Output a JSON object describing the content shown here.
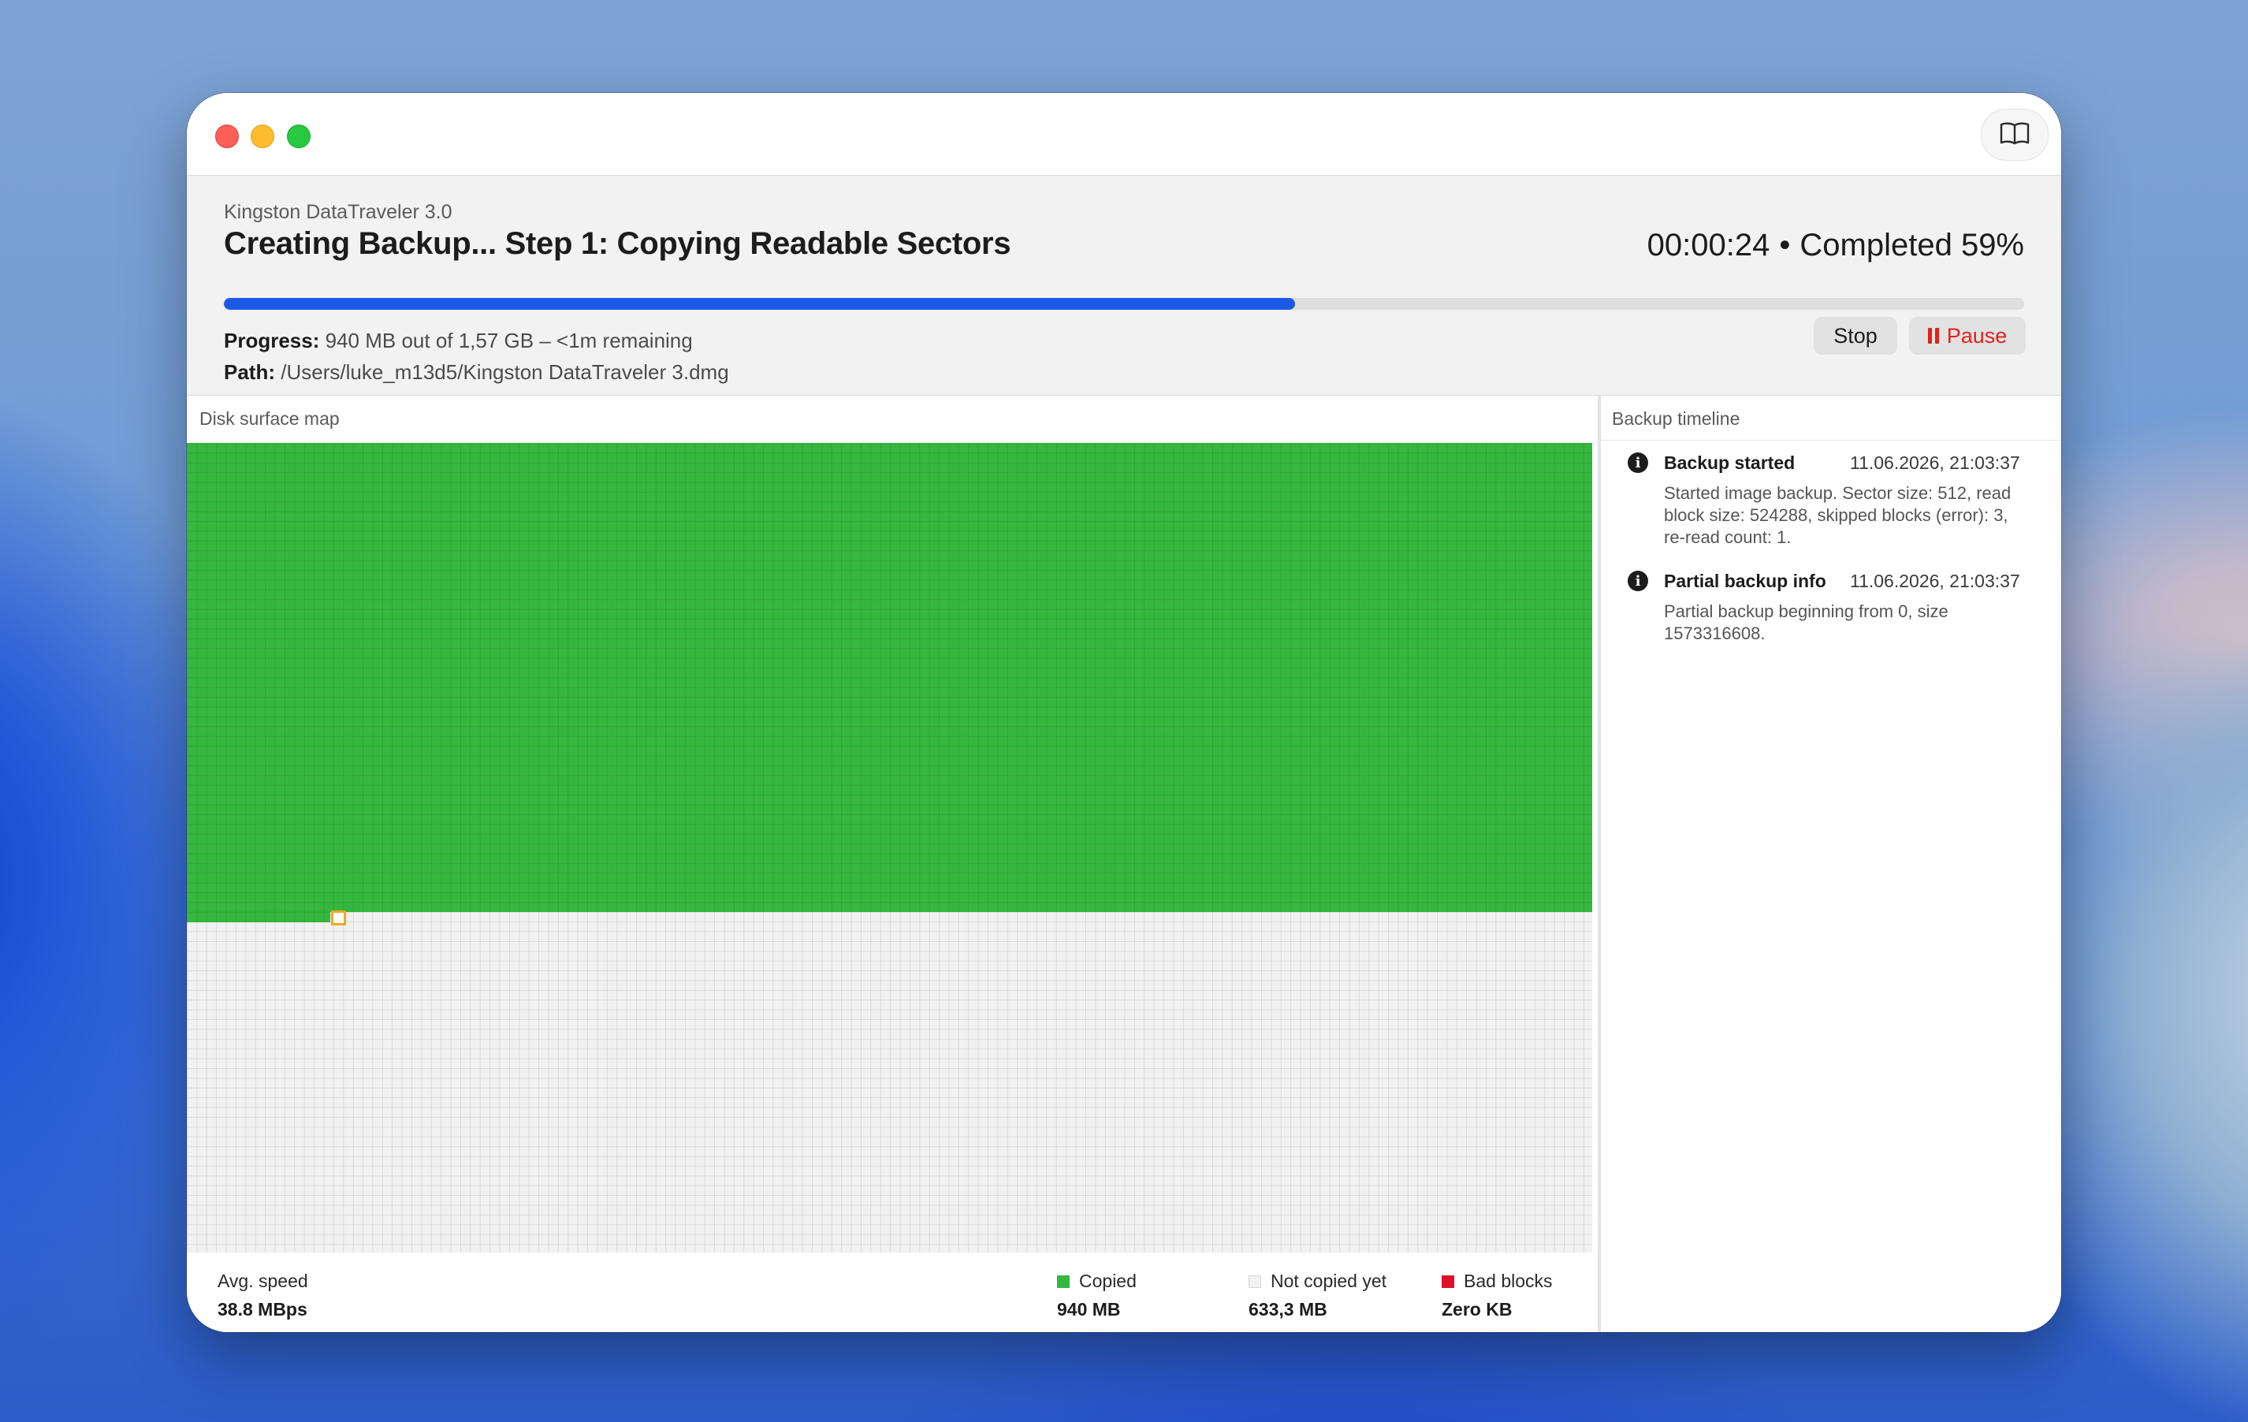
{
  "window": {
    "help_icon": "book-icon"
  },
  "header": {
    "device": "Kingston DataTraveler 3.0",
    "title": "Creating Backup... Step 1: Copying Readable Sectors",
    "elapsed": "00:00:24",
    "separator": "•",
    "completed": "Completed 59%",
    "progress_percent": 59.5,
    "progress_label": "Progress:",
    "progress_value": "940 MB out of 1,57 GB – <1m remaining",
    "path_label": "Path:",
    "path_value": "/Users/luke_m13d5/Kingston DataTraveler 3.dmg",
    "stop_label": "Stop",
    "pause_label": "Pause"
  },
  "map": {
    "label": "Disk surface map",
    "copied_fraction": 0.6
  },
  "stats": {
    "avg_speed_label": "Avg. speed",
    "avg_speed_value": "38.8 MBps",
    "copied_label": "Copied",
    "copied_value": "940 MB",
    "not_copied_label": "Not copied yet",
    "not_copied_value": "633,3 MB",
    "bad_label": "Bad blocks",
    "bad_value": "Zero KB",
    "colors": {
      "copied": "#35b73e",
      "not_copied": "#f1f1f1",
      "bad": "#e0102a",
      "cursor": "#f2a820"
    }
  },
  "timeline": {
    "label": "Backup timeline",
    "items": [
      {
        "icon": "info-icon",
        "title": "Backup started",
        "time": "11.06.2026, 21:03:37",
        "description": "Started image backup. Sector size: 512, read block size: 524288, skipped blocks (error): 3, re-read count: 1."
      },
      {
        "icon": "info-icon",
        "title": "Partial backup info",
        "time": "11.06.2026, 21:03:37",
        "description": "Partial backup beginning from 0, size 1573316608."
      }
    ]
  }
}
